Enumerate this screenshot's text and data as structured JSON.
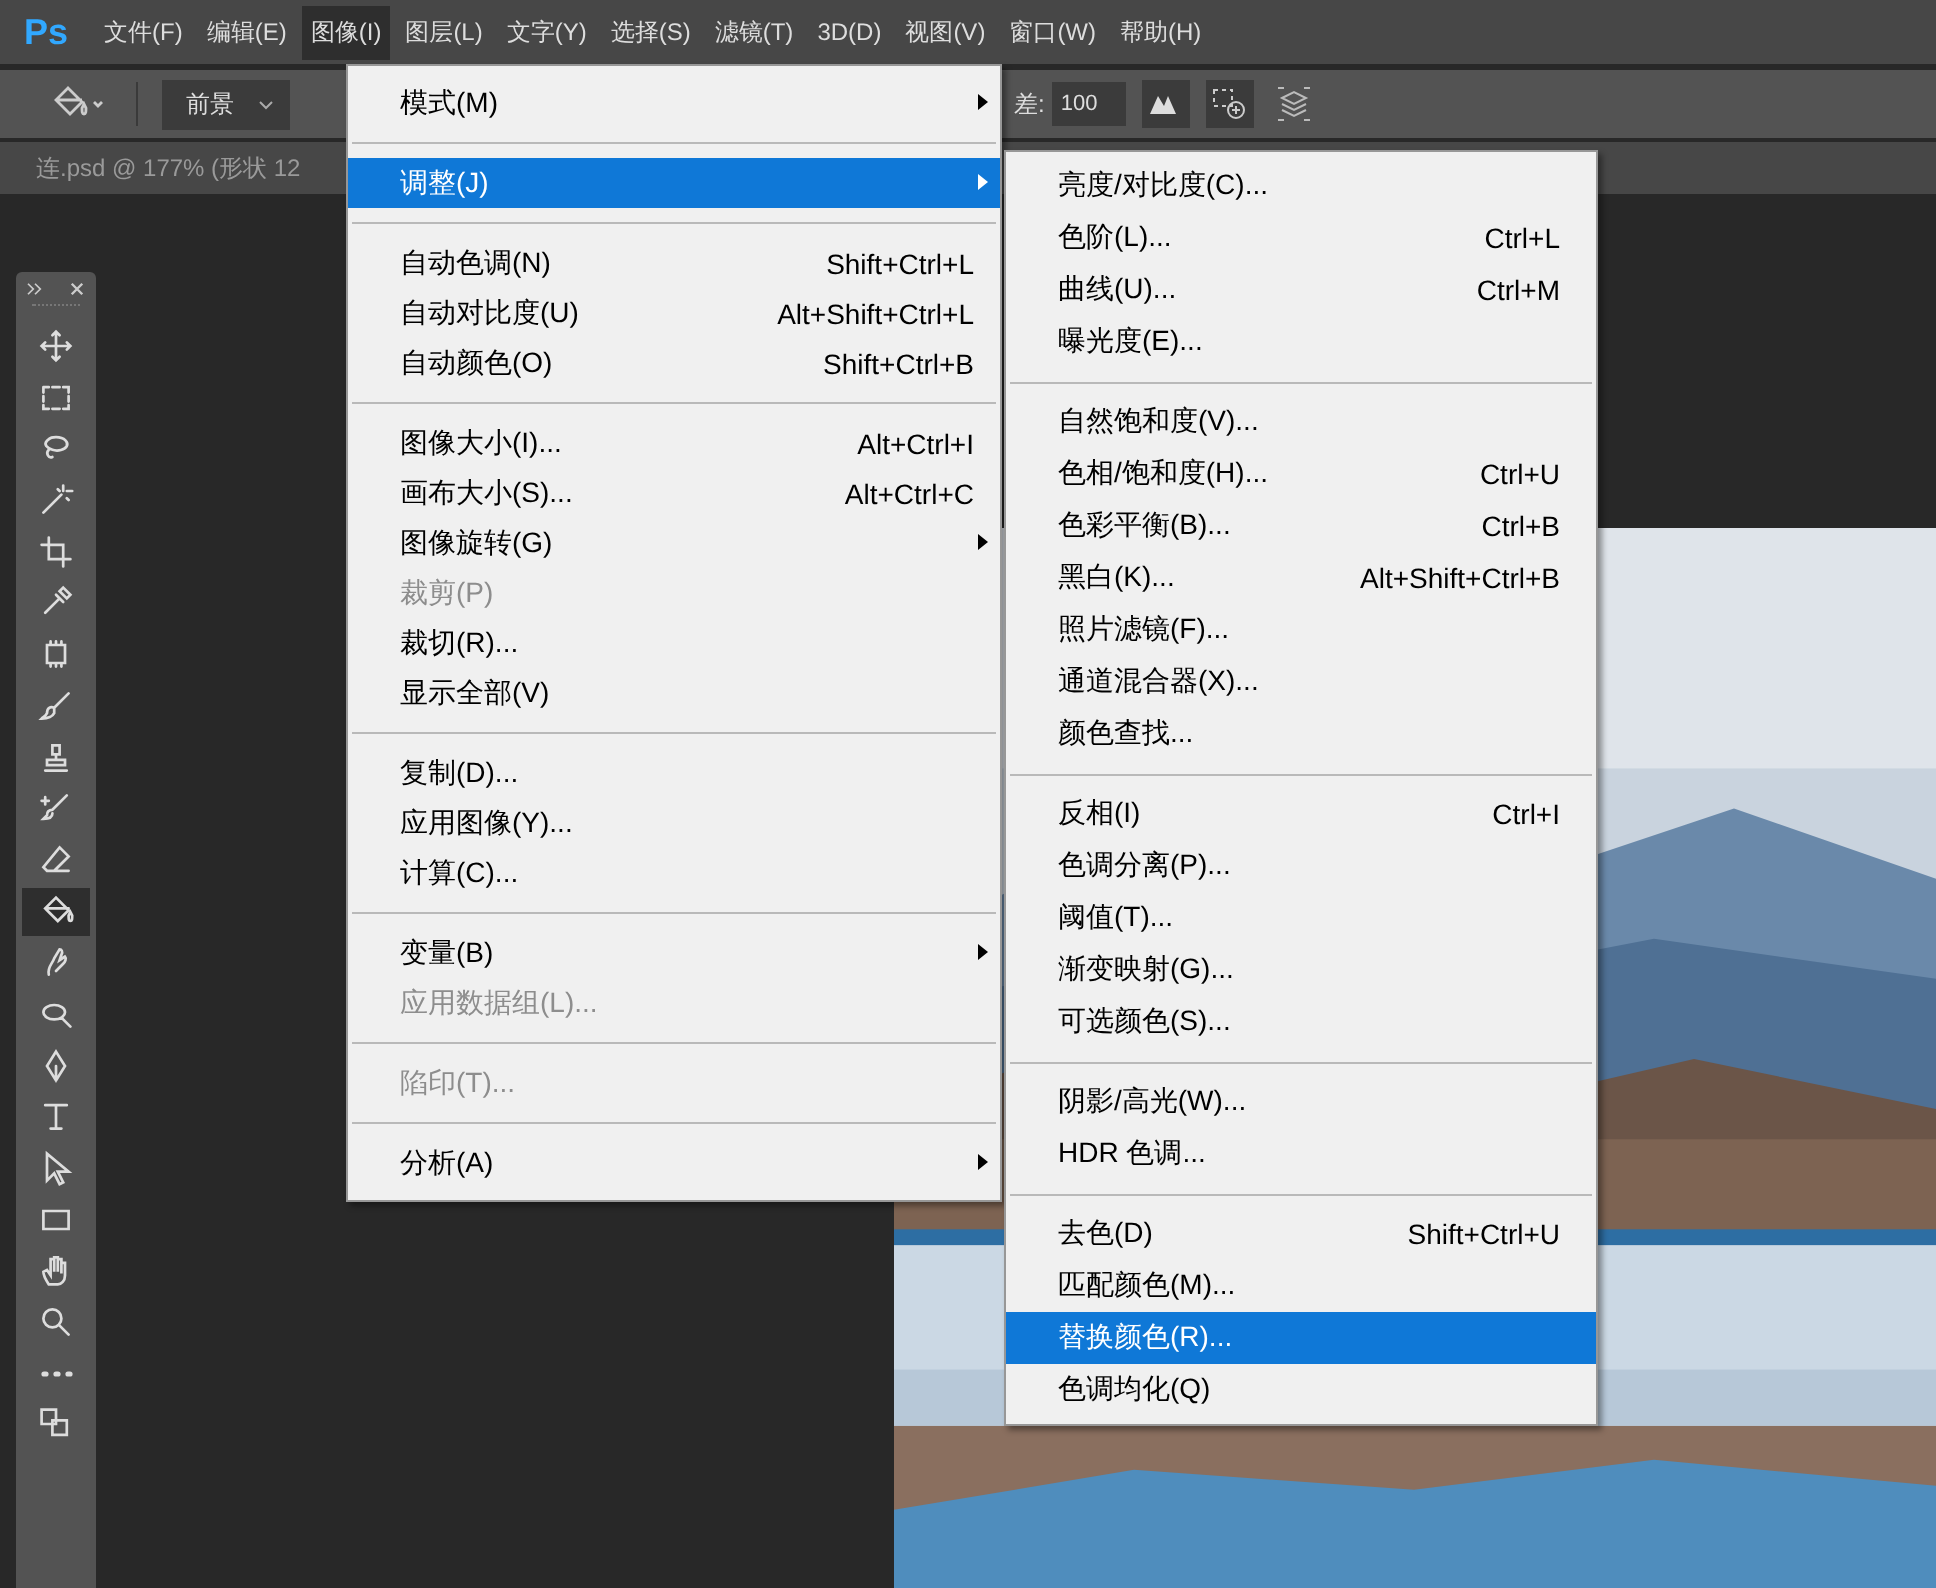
{
  "app_logo": "Ps",
  "menu_bar": [
    {
      "label": "文件(F)",
      "selected": false
    },
    {
      "label": "编辑(E)",
      "selected": false
    },
    {
      "label": "图像(I)",
      "selected": true
    },
    {
      "label": "图层(L)",
      "selected": false
    },
    {
      "label": "文字(Y)",
      "selected": false
    },
    {
      "label": "选择(S)",
      "selected": false
    },
    {
      "label": "滤镜(T)",
      "selected": false
    },
    {
      "label": "3D(D)",
      "selected": false
    },
    {
      "label": "视图(V)",
      "selected": false
    },
    {
      "label": "窗口(W)",
      "selected": false
    },
    {
      "label": "帮助(H)",
      "selected": false
    }
  ],
  "options_bar": {
    "fill_source": "前景",
    "tolerance_label": "差:",
    "tolerance_value": "100"
  },
  "document_tab": "连.psd @ 177% (形状 12",
  "toolbar": [
    {
      "kind": "move",
      "selected": false
    },
    {
      "kind": "marquee",
      "selected": false
    },
    {
      "kind": "lasso",
      "selected": false
    },
    {
      "kind": "wand",
      "selected": false
    },
    {
      "kind": "crop",
      "selected": false
    },
    {
      "kind": "eyedropper",
      "selected": false
    },
    {
      "kind": "patch",
      "selected": false
    },
    {
      "kind": "brush",
      "selected": false
    },
    {
      "kind": "stamp",
      "selected": false
    },
    {
      "kind": "history",
      "selected": false
    },
    {
      "kind": "eraser",
      "selected": false
    },
    {
      "kind": "bucket",
      "selected": true
    },
    {
      "kind": "smudge",
      "selected": false
    },
    {
      "kind": "dodge",
      "selected": false
    },
    {
      "kind": "pen",
      "selected": false
    },
    {
      "kind": "type",
      "selected": false
    },
    {
      "kind": "select",
      "selected": false
    },
    {
      "kind": "rect",
      "selected": false
    },
    {
      "kind": "hand",
      "selected": false
    },
    {
      "kind": "zoom",
      "selected": false
    },
    {
      "kind": "more",
      "selected": false
    },
    {
      "kind": "colors",
      "selected": false
    }
  ],
  "canvas": {
    "kind": "picture"
  },
  "image_menu": [
    [
      {
        "label": "模式(M)",
        "submenu": true,
        "disabled": false,
        "selected": false
      }
    ],
    [
      {
        "label": "调整(J)",
        "submenu": true,
        "disabled": false,
        "selected": true
      }
    ],
    [
      {
        "label": "自动色调(N)",
        "shortcut": "Shift+Ctrl+L",
        "submenu": false,
        "disabled": false,
        "selected": false
      },
      {
        "label": "自动对比度(U)",
        "shortcut": "Alt+Shift+Ctrl+L",
        "submenu": false,
        "disabled": false,
        "selected": false
      },
      {
        "label": "自动颜色(O)",
        "shortcut": "Shift+Ctrl+B",
        "submenu": false,
        "disabled": false,
        "selected": false
      }
    ],
    [
      {
        "label": "图像大小(I)...",
        "shortcut": "Alt+Ctrl+I",
        "submenu": false,
        "disabled": false,
        "selected": false
      },
      {
        "label": "画布大小(S)...",
        "shortcut": "Alt+Ctrl+C",
        "submenu": false,
        "disabled": false,
        "selected": false
      },
      {
        "label": "图像旋转(G)",
        "submenu": true,
        "disabled": false,
        "selected": false
      },
      {
        "label": "裁剪(P)",
        "submenu": false,
        "disabled": true,
        "selected": false
      },
      {
        "label": "裁切(R)...",
        "submenu": false,
        "disabled": false,
        "selected": false
      },
      {
        "label": "显示全部(V)",
        "submenu": false,
        "disabled": false,
        "selected": false
      }
    ],
    [
      {
        "label": "复制(D)...",
        "submenu": false,
        "disabled": false,
        "selected": false
      },
      {
        "label": "应用图像(Y)...",
        "submenu": false,
        "disabled": false,
        "selected": false
      },
      {
        "label": "计算(C)...",
        "submenu": false,
        "disabled": false,
        "selected": false
      }
    ],
    [
      {
        "label": "变量(B)",
        "submenu": true,
        "disabled": false,
        "selected": false
      },
      {
        "label": "应用数据组(L)...",
        "submenu": false,
        "disabled": true,
        "selected": false
      }
    ],
    [
      {
        "label": "陷印(T)...",
        "submenu": false,
        "disabled": true,
        "selected": false
      }
    ],
    [
      {
        "label": "分析(A)",
        "submenu": true,
        "disabled": false,
        "selected": false
      }
    ]
  ],
  "adjustments_submenu": [
    [
      {
        "label": "亮度/对比度(C)...",
        "selected": false
      },
      {
        "label": "色阶(L)...",
        "shortcut": "Ctrl+L",
        "selected": false
      },
      {
        "label": "曲线(U)...",
        "shortcut": "Ctrl+M",
        "selected": false
      },
      {
        "label": "曝光度(E)...",
        "selected": false
      }
    ],
    [
      {
        "label": "自然饱和度(V)...",
        "selected": false
      },
      {
        "label": "色相/饱和度(H)...",
        "shortcut": "Ctrl+U",
        "selected": false
      },
      {
        "label": "色彩平衡(B)...",
        "shortcut": "Ctrl+B",
        "selected": false
      },
      {
        "label": "黑白(K)...",
        "shortcut": "Alt+Shift+Ctrl+B",
        "selected": false
      },
      {
        "label": "照片滤镜(F)...",
        "selected": false
      },
      {
        "label": "通道混合器(X)...",
        "selected": false
      },
      {
        "label": "颜色查找...",
        "selected": false
      }
    ],
    [
      {
        "label": "反相(I)",
        "shortcut": "Ctrl+I",
        "selected": false
      },
      {
        "label": "色调分离(P)...",
        "selected": false
      },
      {
        "label": "阈值(T)...",
        "selected": false
      },
      {
        "label": "渐变映射(G)...",
        "selected": false
      },
      {
        "label": "可选颜色(S)...",
        "selected": false
      }
    ],
    [
      {
        "label": "阴影/高光(W)...",
        "selected": false
      },
      {
        "label": "HDR 色调...",
        "selected": false
      }
    ],
    [
      {
        "label": "去色(D)",
        "shortcut": "Shift+Ctrl+U",
        "selected": false
      },
      {
        "label": "匹配颜色(M)...",
        "selected": false
      },
      {
        "label": "替换颜色(R)...",
        "selected": true
      },
      {
        "label": "色调均化(Q)",
        "selected": false
      }
    ]
  ]
}
